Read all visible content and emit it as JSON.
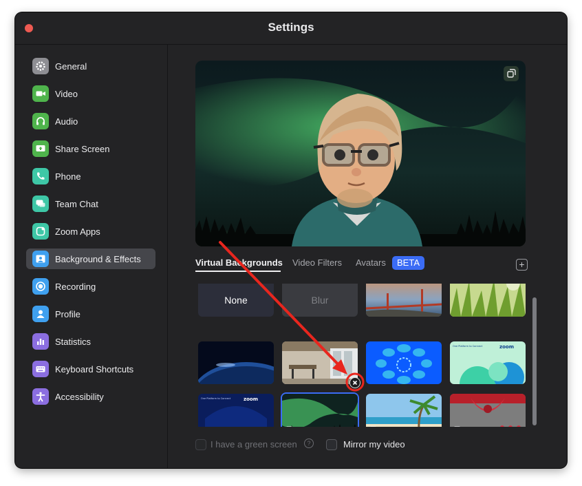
{
  "window": {
    "title": "Settings"
  },
  "sidebar": {
    "items": [
      {
        "label": "General",
        "icon": "gear-icon",
        "color": "#8e8e93"
      },
      {
        "label": "Video",
        "icon": "video-camera-icon",
        "color": "#4fb44c"
      },
      {
        "label": "Audio",
        "icon": "headphones-icon",
        "color": "#4fb44c"
      },
      {
        "label": "Share Screen",
        "icon": "share-screen-icon",
        "color": "#4fb44c"
      },
      {
        "label": "Phone",
        "icon": "phone-icon",
        "color": "#3ec7a6"
      },
      {
        "label": "Team Chat",
        "icon": "chat-icon",
        "color": "#3ec7a6"
      },
      {
        "label": "Zoom Apps",
        "icon": "apps-icon",
        "color": "#3ec7a6"
      },
      {
        "label": "Background & Effects",
        "icon": "background-icon",
        "color": "#3fa0ef"
      },
      {
        "label": "Recording",
        "icon": "record-icon",
        "color": "#3fa0ef"
      },
      {
        "label": "Profile",
        "icon": "person-icon",
        "color": "#3fa0ef"
      },
      {
        "label": "Statistics",
        "icon": "bar-chart-icon",
        "color": "#8b6ee0"
      },
      {
        "label": "Keyboard Shortcuts",
        "icon": "keyboard-icon",
        "color": "#8b6ee0"
      },
      {
        "label": "Accessibility",
        "icon": "accessibility-icon",
        "color": "#8b6ee0"
      }
    ],
    "active_index": 7
  },
  "tabs": {
    "virtual_backgrounds": "Virtual Backgrounds",
    "video_filters": "Video Filters",
    "avatars": "Avatars",
    "beta": "BETA",
    "add": "+"
  },
  "backgrounds": {
    "none": "None",
    "blur": "Blur",
    "items": [
      {
        "name": "golden-gate-bridge",
        "icon": "image-icon"
      },
      {
        "name": "grass",
        "icon": "image-icon"
      },
      {
        "name": "earth-from-space",
        "icon": "image-icon"
      },
      {
        "name": "modern-office",
        "icon": "image-icon"
      },
      {
        "name": "zoom-blue-pattern",
        "icon": "image-icon"
      },
      {
        "name": "zoom-green-pattern",
        "icon": "image-icon"
      },
      {
        "name": "zoom-navy-pattern",
        "icon": "image-icon"
      },
      {
        "name": "aurora-borealis",
        "icon": "video-icon",
        "selected": true
      },
      {
        "name": "tropical-beach",
        "icon": "video-icon"
      },
      {
        "name": "holiday-ribbon",
        "icon": "video-icon"
      }
    ],
    "zoom_brand": "zoom",
    "zoom_caption": "One Platform to Connect"
  },
  "options": {
    "green_screen": "I have a green screen",
    "mirror": "Mirror my video",
    "help": "?"
  },
  "colors": {
    "accent": "#3b6cf5",
    "annotation": "#e8261e",
    "window_bg": "#232325"
  }
}
